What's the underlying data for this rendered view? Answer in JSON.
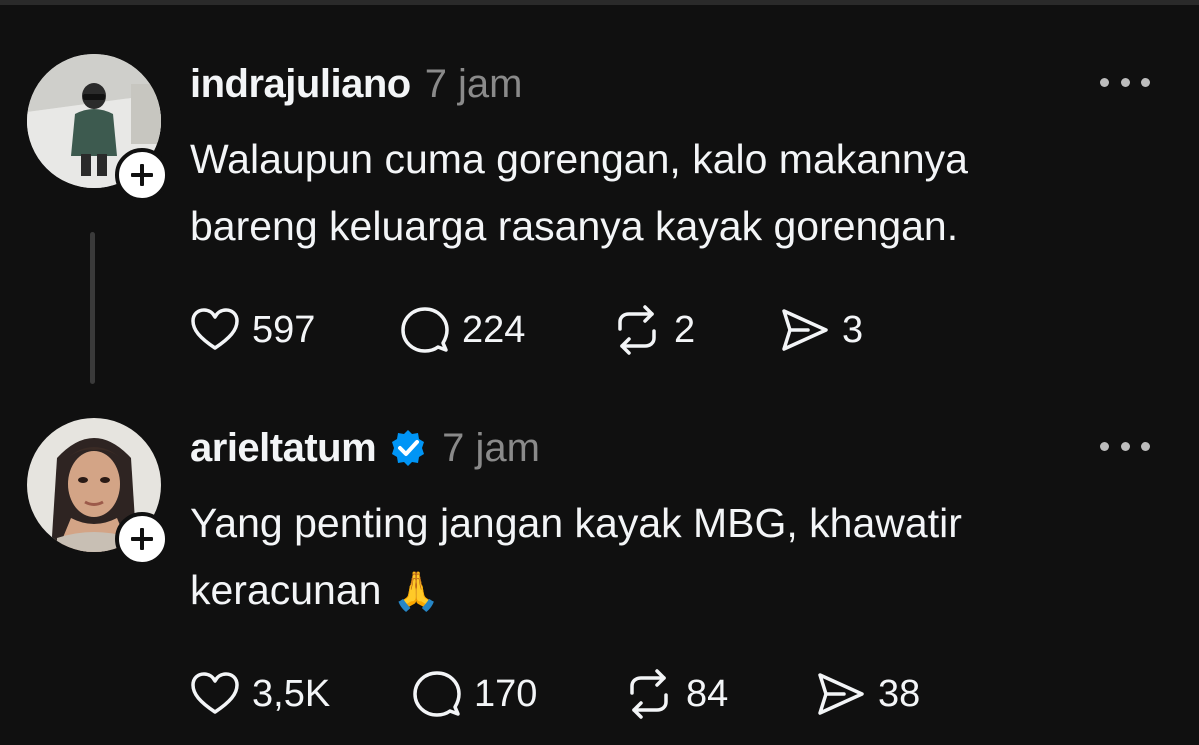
{
  "posts": [
    {
      "username": "indrajuliano",
      "time": "7 jam",
      "verified": false,
      "text_lines": [
        "Walaupun cuma gorengan, kalo makannya",
        "bareng keluarga rasanya kayak gorengan."
      ],
      "emoji": "",
      "likes": "597",
      "replies": "224",
      "reposts": "2",
      "shares": "3"
    },
    {
      "username": "arieltatum",
      "time": "7 jam",
      "verified": true,
      "text_lines": [
        "Yang penting jangan kayak MBG, khawatir",
        "keracunan"
      ],
      "emoji": "🙏",
      "likes": "3,5K",
      "replies": "170",
      "reposts": "84",
      "shares": "38"
    }
  ],
  "colors": {
    "background": "#101010",
    "text": "#f3f5f7",
    "muted": "#8a8a8a",
    "verified": "#0095f6"
  },
  "icons": [
    "plus-icon",
    "verified-icon",
    "more-icon",
    "heart-icon",
    "comment-icon",
    "repost-icon",
    "share-icon"
  ]
}
